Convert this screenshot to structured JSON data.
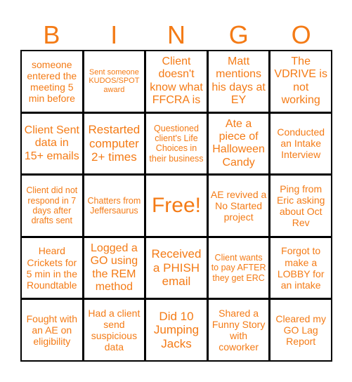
{
  "header": {
    "letters": [
      "B",
      "I",
      "N",
      "G",
      "O"
    ]
  },
  "accent_color": "#F47B16",
  "cells": [
    {
      "text": "someone entered the meeting 5 min before",
      "size": "m"
    },
    {
      "text": "Sent someone KUDOS/SPOT award",
      "size": "xs"
    },
    {
      "text": "Client doesn't know what FFCRA is",
      "size": "l"
    },
    {
      "text": "Matt mentions his days at EY",
      "size": "l"
    },
    {
      "text": "The VDRIVE is not working",
      "size": "l"
    },
    {
      "text": "Client Sent data in 15+ emails",
      "size": "l"
    },
    {
      "text": "Restarted computer 2+ times",
      "size": "xl"
    },
    {
      "text": "Questioned client's Life Choices in their business",
      "size": "s"
    },
    {
      "text": "Ate a piece of Halloween Candy",
      "size": "l"
    },
    {
      "text": "Conducted an Intake Interview",
      "size": "m"
    },
    {
      "text": "Client did not respond in 7 days after drafts sent",
      "size": "s"
    },
    {
      "text": "Chatters from Jeffersaurus",
      "size": "s"
    },
    {
      "text": "Free!",
      "size": "free"
    },
    {
      "text": "AE revived a No Started project",
      "size": "m"
    },
    {
      "text": "Ping from Eric asking about Oct Rev",
      "size": "m"
    },
    {
      "text": "Heard Crickets for 5 min in the Roundtable",
      "size": "m"
    },
    {
      "text": "Logged a GO using the REM method",
      "size": "l"
    },
    {
      "text": "Received a PHISH email",
      "size": "xl"
    },
    {
      "text": "Client wants to pay AFTER they get ERC",
      "size": "s"
    },
    {
      "text": "Forgot to make a LOBBY for an intake",
      "size": "m"
    },
    {
      "text": "Fought with an AE on eligibility",
      "size": "m"
    },
    {
      "text": "Had a client send suspicious data",
      "size": "m"
    },
    {
      "text": "Did 10 Jumping Jacks",
      "size": "xl"
    },
    {
      "text": "Shared a Funny Story with coworker",
      "size": "m"
    },
    {
      "text": "Cleared my GO Lag Report",
      "size": "m"
    }
  ]
}
